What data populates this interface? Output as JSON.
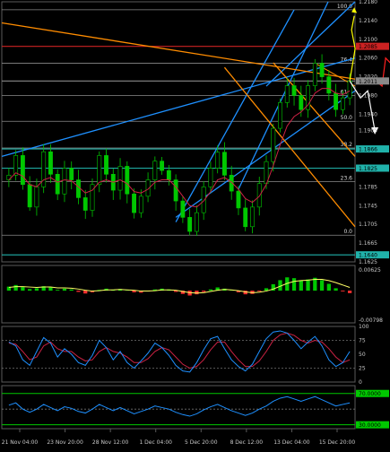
{
  "chart_data": [
    {
      "type": "line",
      "title": "",
      "panel": "price",
      "ylim": [
        1.1625,
        1.218
      ],
      "y_ticks": [
        "1.2180",
        "1.2140",
        "1.2100",
        "1.2060",
        "1.2020",
        "1.1980",
        "1.1940",
        "1.1905",
        "1.1865",
        "1.1825",
        "1.1785",
        "1.1745",
        "1.1705",
        "1.1665",
        "1.1625"
      ],
      "price_lines": [
        {
          "label": "1.2085",
          "value": 1.2085,
          "color": "#cc2222"
        },
        {
          "label": "1.2011",
          "value": 1.2011,
          "color": "#8a8a8a"
        },
        {
          "label": "1.1866",
          "value": 1.1866,
          "color": "#20b2aa"
        },
        {
          "label": "1.1825",
          "value": 1.1825,
          "color": "#20b2aa"
        },
        {
          "label": "1.1640",
          "value": 1.164,
          "color": "#20b2aa"
        }
      ],
      "fib_levels": [
        {
          "label": "100.0",
          "value": 1.2163
        },
        {
          "label": "76.4",
          "value": 1.2049
        },
        {
          "label": "61.8",
          "value": 1.198
        },
        {
          "label": "50.0",
          "value": 1.1925
        },
        {
          "label": "38.2",
          "value": 1.1868
        },
        {
          "label": "23.6",
          "value": 1.1796
        },
        {
          "label": "0.0",
          "value": 1.1682
        }
      ],
      "series": [
        {
          "values": [
            1.181,
            1.1852,
            1.179,
            1.1742,
            1.1785,
            1.186,
            1.1812,
            1.177,
            1.1825,
            1.18,
            1.1762,
            1.1735,
            1.179,
            1.1852,
            1.1812,
            1.1778,
            1.1829,
            1.177,
            1.173,
            1.1765,
            1.18,
            1.184,
            1.182,
            1.18,
            1.1755,
            1.172,
            1.169,
            1.173,
            1.1785,
            1.1825,
            1.1859,
            1.181,
            1.1776,
            1.174,
            1.17,
            1.1742,
            1.1792,
            1.1839,
            1.191,
            1.1965,
            1.2001,
            1.198,
            1.195,
            1.2001,
            1.2049,
            1.202,
            1.1985,
            1.195,
            1.1975,
            1.2011
          ]
        },
        {
          "values": [
            1.18,
            1.1815,
            1.1808,
            1.179,
            1.1785,
            1.18,
            1.1805,
            1.1795,
            1.18,
            1.1798,
            1.1785,
            1.1772,
            1.1778,
            1.1795,
            1.18,
            1.1795,
            1.18,
            1.1792,
            1.1775,
            1.1772,
            1.178,
            1.1795,
            1.18,
            1.18,
            1.1785,
            1.1765,
            1.1745,
            1.1742,
            1.1755,
            1.1775,
            1.18,
            1.1805,
            1.1795,
            1.178,
            1.176,
            1.1752,
            1.1765,
            1.179,
            1.183,
            1.1875,
            1.1915,
            1.1935,
            1.1945,
            1.196,
            1.1985,
            1.1995,
            1.1995,
            1.1985,
            1.1982,
            1.199
          ]
        }
      ]
    },
    {
      "type": "bar",
      "title": "",
      "panel": "macd",
      "ylim": [
        -0.00798,
        0.00625
      ],
      "y_ticks": [
        "0.00625",
        "-0.00798"
      ],
      "values": [
        0.001,
        0.0014,
        0.0009,
        0.0004,
        0.0006,
        0.0011,
        0.0008,
        0.0002,
        0.0005,
        0.0003,
        -0.0003,
        -0.0007,
        -0.0004,
        0.0002,
        0.0005,
        0.0002,
        0.0004,
        0.0001,
        -0.0004,
        -0.0005,
        -0.0002,
        0.0003,
        0.0005,
        0.0003,
        -0.0003,
        -0.0008,
        -0.0012,
        -0.0009,
        -0.0003,
        0.0003,
        0.0008,
        0.0005,
        0.0001,
        -0.0004,
        -0.0009,
        -0.0008,
        -0.0002,
        0.0006,
        0.0016,
        0.0026,
        0.0033,
        0.0031,
        0.0026,
        0.0028,
        0.0032,
        0.0026,
        0.0017,
        0.0006,
        -0.0002,
        -0.0006
      ],
      "series": [
        {
          "values": [
            0.0008,
            0.001,
            0.001,
            0.0009,
            0.0008,
            0.0009,
            0.0009,
            0.0007,
            0.0007,
            0.0006,
            0.0004,
            0.0001,
            -0.0001,
            0.0,
            0.0002,
            0.0002,
            0.0003,
            0.0002,
            0.0001,
            -0.0001,
            -0.0001,
            0.0,
            0.0002,
            0.0002,
            0.0001,
            -0.0002,
            -0.0005,
            -0.0006,
            -0.0005,
            -0.0002,
            0.0001,
            0.0003,
            0.0002,
            0.0,
            -0.0003,
            -0.0005,
            -0.0004,
            -0.0001,
            0.0004,
            0.0011,
            0.0018,
            0.0023,
            0.0025,
            0.0026,
            0.0028,
            0.0028,
            0.0025,
            0.002,
            0.0014,
            0.0008
          ]
        }
      ]
    },
    {
      "type": "line",
      "title": "",
      "panel": "stochastic",
      "ylim": [
        0,
        100
      ],
      "y_ticks": [
        "100",
        "75",
        "50",
        "25",
        "0"
      ],
      "series": [
        {
          "values": [
            72,
            65,
            40,
            30,
            55,
            80,
            70,
            45,
            60,
            50,
            35,
            30,
            48,
            75,
            62,
            40,
            55,
            35,
            25,
            38,
            52,
            70,
            62,
            48,
            30,
            20,
            18,
            35,
            58,
            78,
            82,
            60,
            40,
            28,
            20,
            32,
            55,
            78,
            90,
            92,
            88,
            75,
            60,
            72,
            82,
            65,
            40,
            28,
            35,
            55
          ]
        },
        {
          "values": [
            70,
            68,
            55,
            40,
            45,
            65,
            72,
            60,
            55,
            55,
            45,
            38,
            40,
            55,
            62,
            55,
            52,
            45,
            35,
            35,
            42,
            55,
            62,
            58,
            45,
            32,
            25,
            28,
            40,
            58,
            72,
            72,
            55,
            40,
            28,
            28,
            38,
            55,
            75,
            85,
            88,
            84,
            75,
            70,
            75,
            72,
            60,
            45,
            35,
            40
          ]
        }
      ]
    },
    {
      "type": "line",
      "title": "",
      "panel": "rsi",
      "ylim": [
        25,
        80
      ],
      "y_ticks": [],
      "levels": [
        {
          "label": "70.0000",
          "value": 70
        },
        {
          "label": "30.0000",
          "value": 30
        }
      ],
      "series": [
        {
          "values": [
            55,
            58,
            50,
            46,
            50,
            56,
            52,
            48,
            53,
            51,
            47,
            45,
            50,
            56,
            52,
            48,
            52,
            48,
            44,
            47,
            50,
            54,
            52,
            50,
            46,
            43,
            41,
            44,
            49,
            53,
            56,
            52,
            48,
            45,
            42,
            45,
            50,
            54,
            60,
            64,
            66,
            63,
            60,
            63,
            66,
            62,
            58,
            54,
            56,
            58
          ]
        }
      ]
    }
  ],
  "x_axis_labels": [
    "21 Nov 04:00",
    "23 Nov 20:00",
    "28 Nov 12:00",
    "1 Dec 04:00",
    "5 Dec 20:00",
    "8 Dec 12:00",
    "13 Dec 04:00",
    "15 Dec 20:00"
  ],
  "colors": {
    "background": "#000000",
    "bull_candle": "#00c800",
    "bear_candle": "#00c800",
    "ma": "#cc2244",
    "trend_blue": "#1e90ff",
    "trend_orange": "#ff8c00",
    "fib": "#8a8a8a",
    "macd_pos": "#00c800",
    "macd_neg": "#ff3030",
    "macd_signal": "#ffff66",
    "stoch_main": "#1e90ff",
    "stoch_signal": "#cc2244",
    "rsi": "#1e90ff",
    "arrow_yellow": "#ffff00",
    "arrow_white": "#ffffff",
    "arrow_red": "#ff2020",
    "axis_text": "#c8c8c8",
    "grid": "#404040"
  }
}
